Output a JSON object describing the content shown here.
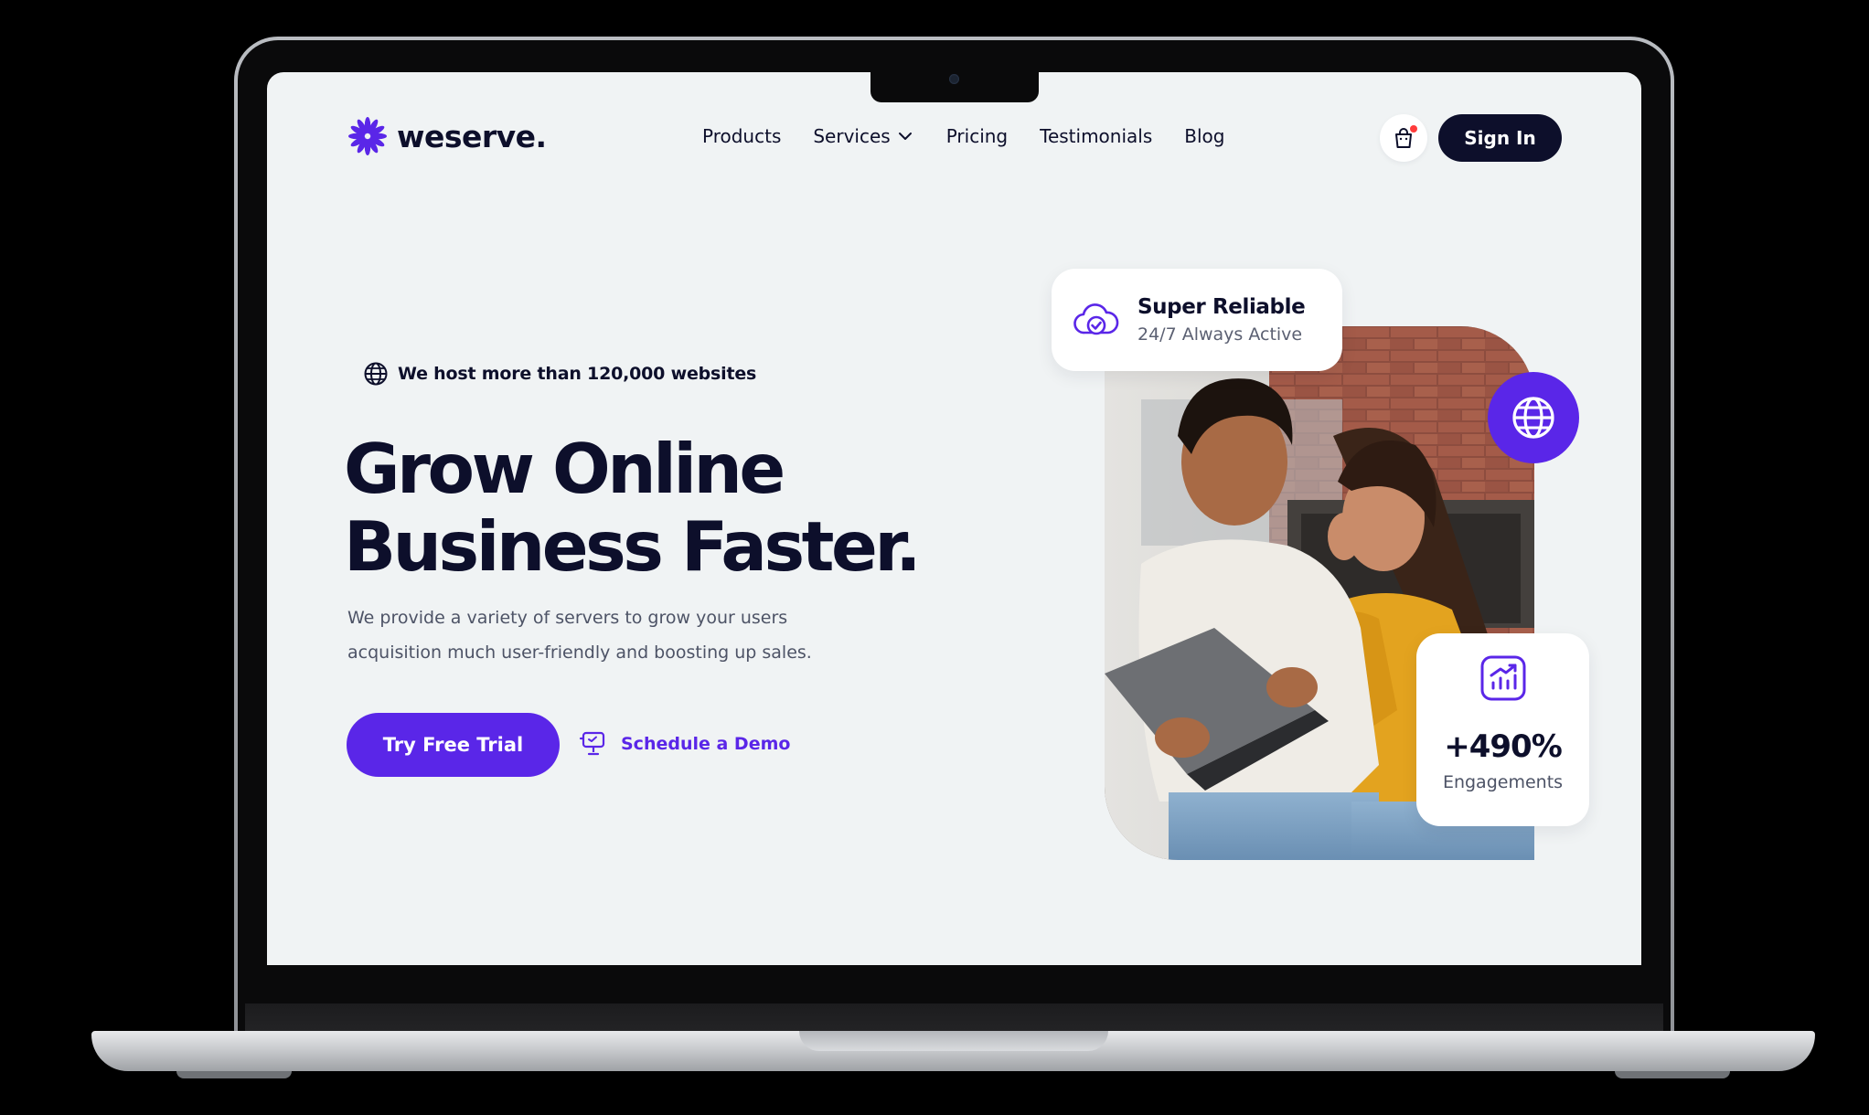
{
  "brand": {
    "name": "weserve.",
    "logo_icon": "flower-burst-icon",
    "accent_color": "#5a26e8"
  },
  "nav": {
    "items": [
      {
        "label": "Products"
      },
      {
        "label": "Services",
        "has_dropdown": true
      },
      {
        "label": "Pricing"
      },
      {
        "label": "Testimonials"
      },
      {
        "label": "Blog"
      }
    ],
    "cart_icon": "shopping-bag-icon",
    "cart_has_notification": true,
    "signin_label": "Sign In"
  },
  "hero": {
    "badge_text": "We host more than 120,000 websites",
    "badge_icon": "globe-icon",
    "title_line1": "Grow Online",
    "title_line2": "Business Faster.",
    "description_line1": "We provide a variety of servers to grow your users",
    "description_line2": "acquisition much user-friendly and boosting up sales.",
    "primary_cta": "Try Free Trial",
    "secondary_cta": "Schedule a Demo",
    "secondary_cta_icon": "presentation-icon"
  },
  "cards": {
    "reliable": {
      "icon": "cloud-check-icon",
      "title": "Super Reliable",
      "subtitle": "24/7 Always Active"
    },
    "globe_bubble_icon": "globe-icon",
    "engagement": {
      "icon": "chart-up-icon",
      "value": "+490%",
      "label": "Engagements"
    }
  },
  "colors": {
    "primary": "#5a26e8",
    "dark": "#0d0f2b",
    "background": "#f0f3f4",
    "notification": "#ff3b3b"
  }
}
